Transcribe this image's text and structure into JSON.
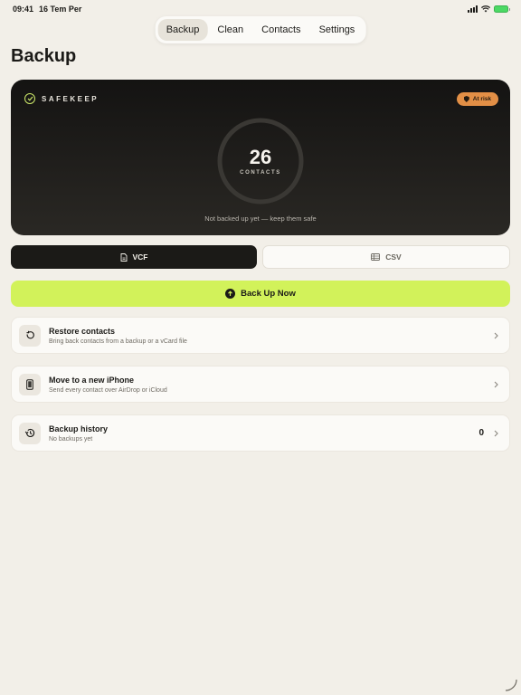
{
  "status": {
    "time": "09:41",
    "date": "16 Tem Per"
  },
  "tabs": [
    {
      "label": "Backup",
      "active": true
    },
    {
      "label": "Clean",
      "active": false
    },
    {
      "label": "Contacts",
      "active": false
    },
    {
      "label": "Settings",
      "active": false
    }
  ],
  "page": {
    "title": "Backup"
  },
  "hero": {
    "brand": "SAFEKEEP",
    "badge": "At risk",
    "count": "26",
    "count_label": "CONTACTS",
    "note": "Not backed up yet — keep them safe"
  },
  "formats": [
    {
      "label": "VCF",
      "icon": "document-icon",
      "active": true
    },
    {
      "label": "CSV",
      "icon": "table-icon",
      "active": false
    }
  ],
  "primary_action": {
    "label": "Back Up Now",
    "icon": "arrow-up-circle-icon"
  },
  "actions": [
    {
      "title": "Restore contacts",
      "subtitle": "Bring back contacts from a backup or a vCard file",
      "icon": "restore-icon"
    },
    {
      "title": "Move to a new iPhone",
      "subtitle": "Send every contact over AirDrop or iCloud",
      "icon": "phone-icon"
    },
    {
      "title": "Backup history",
      "subtitle": "No backups yet",
      "count": "0",
      "icon": "history-icon"
    }
  ],
  "colors": {
    "accent": "#d2f25a",
    "warning": "#e28f46",
    "hero_bg": "#141312",
    "background": "#f2efe8"
  }
}
